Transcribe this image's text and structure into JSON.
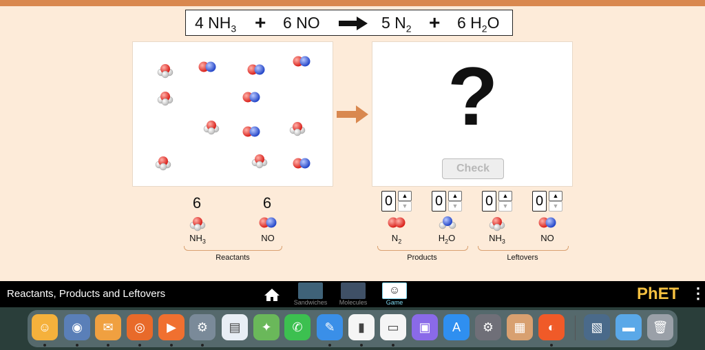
{
  "equation": {
    "terms": [
      "4 NH",
      "3",
      "6 NO",
      "5 N",
      "2",
      "6 H",
      "2",
      "O"
    ],
    "plus": "+"
  },
  "reactants": {
    "counts": [
      "6",
      "6"
    ],
    "labels": {
      "nh3": "NH",
      "nh3_sub": "3",
      "no": "NO"
    },
    "group_label": "Reactants"
  },
  "products": {
    "question_mark": "?",
    "check_label": "Check",
    "spinners": [
      "0",
      "0"
    ],
    "labels": {
      "n2": "N",
      "n2_sub": "2",
      "h2o_h": "H",
      "h2o_sub": "2",
      "h2o_o": "O"
    },
    "group_label": "Products"
  },
  "leftovers": {
    "spinners": [
      "0",
      "0"
    ],
    "labels": {
      "nh3": "NH",
      "nh3_sub": "3",
      "no": "NO"
    },
    "group_label": "Leftovers"
  },
  "navbar": {
    "title": "Reactants, Products and Leftovers",
    "screens": [
      "Sandwiches",
      "Molecules",
      "Game"
    ],
    "logo": "PhET"
  },
  "colors": {
    "accent": "#d9884f",
    "background": "#fdebd9",
    "oxygen": "#e8322b",
    "nitrogen": "#3b5fd9"
  },
  "dock_icons": [
    "finder-icon",
    "contacts-icon",
    "mail-icon",
    "safari-icon",
    "facetime-icon",
    "automator-icon",
    "notes-icon",
    "maps-icon",
    "messages-icon",
    "textedit-icon",
    "numbers-icon",
    "keynote-icon",
    "screen-icon",
    "appstore-icon",
    "system-settings-icon",
    "photo-icon",
    "firefox-icon",
    "image-icon",
    "folder-icon",
    "trash-icon"
  ]
}
